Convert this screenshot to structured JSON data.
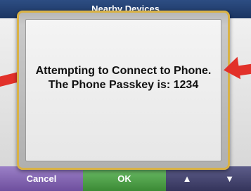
{
  "header": {
    "title": "Nearby Devices"
  },
  "bottom_bar": {
    "cancel_label": "Cancel",
    "ok_label": "OK",
    "up_label": "▲",
    "down_label": "▼"
  },
  "dialog": {
    "message": "Attempting to Connect to Phone. The Phone Passkey is: 1234"
  },
  "colors": {
    "accent_border": "#d9b245",
    "arrow": "#e2312a",
    "cancel": "#7d5fb0",
    "ok": "#4aa043"
  }
}
